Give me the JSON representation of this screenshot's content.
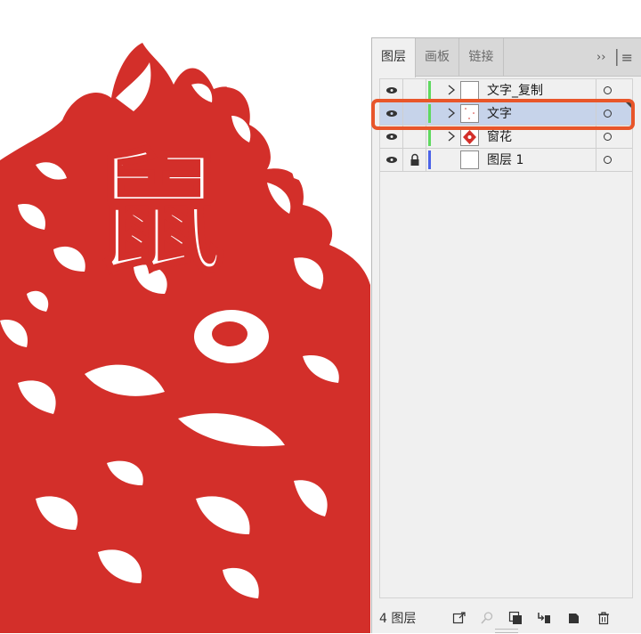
{
  "panel": {
    "tabs": [
      {
        "label": "图层",
        "active": true
      },
      {
        "label": "画板",
        "active": false
      },
      {
        "label": "链接",
        "active": false
      }
    ],
    "menu_expand": "››",
    "layers": [
      {
        "name": "文字_复制",
        "color": "#5fd95f",
        "expandable": true,
        "visible": true,
        "locked": false,
        "selected": false,
        "thumbnail": "blank"
      },
      {
        "name": "文字",
        "color": "#5fd95f",
        "expandable": true,
        "visible": true,
        "locked": false,
        "selected": true,
        "thumbnail": "blank-with-marks"
      },
      {
        "name": "窗花",
        "color": "#5fd95f",
        "expandable": true,
        "visible": true,
        "locked": false,
        "selected": false,
        "thumbnail": "red-papercut"
      },
      {
        "name": "图层 1",
        "color": "#4b63e8",
        "expandable": false,
        "visible": true,
        "locked": true,
        "selected": false,
        "thumbnail": "blank"
      }
    ],
    "footer": {
      "count_text": "4 图层",
      "icons": [
        "export-icon",
        "search-icon",
        "clipping-mask-icon",
        "new-sublayer-icon",
        "new-layer-icon",
        "trash-icon"
      ]
    }
  },
  "highlight_color": "#e8562a",
  "artwork": {
    "description_color": "#d32f2a",
    "glyph": "鼠"
  }
}
